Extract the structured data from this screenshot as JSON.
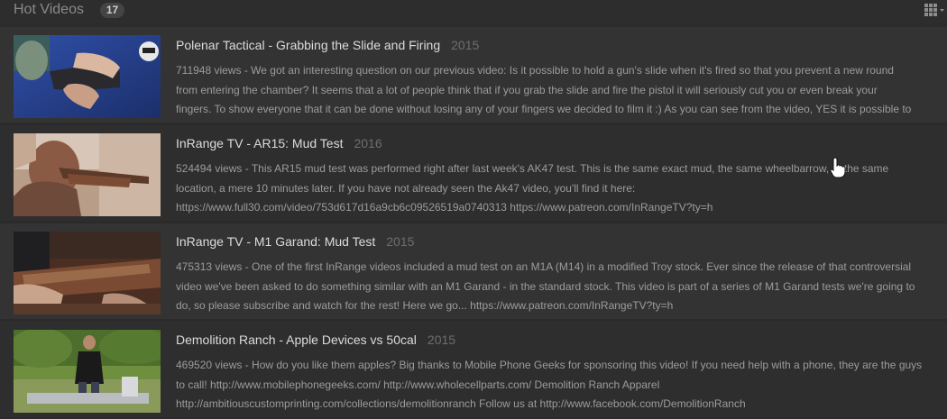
{
  "header": {
    "title": "Hot Videos",
    "count": "17",
    "view_toggle_icon": "grid-icon"
  },
  "videos": [
    {
      "title": "Polenar Tactical - Grabbing the Slide and Firing",
      "year": "2015",
      "description_lines": [
        "711948 views - We got an interesting question on our previous video: Is it possible to hold a gun's slide when it's fired so that you prevent a new round",
        "from entering the chamber? It seems that a lot of people think that if you grab the slide and fire the pistol it will seriously cut you or even break your",
        "fingers. To show everyone that it can be done without losing any of your fingers we decided to film it :) As you can see from the video, YES it is possible to"
      ]
    },
    {
      "title": "InRange TV - AR15: Mud Test",
      "year": "2016",
      "description_lines": [
        "524494 views - This AR15 mud test was performed right after last week's AK47 test. This is the same exact mud, the same wheelbarrow, at the same",
        "location, a mere 10 minutes later. If you have not already seen the Ak47 video, you'll find it here:",
        "https://www.full30.com/video/753d617d16a9cb6c09526519a0740313 https://www.patreon.com/InRangeTV?ty=h"
      ]
    },
    {
      "title": "InRange TV - M1 Garand: Mud Test",
      "year": "2015",
      "description_lines": [
        "475313 views - One of the first InRange videos included a mud test on an M1A (M14) in a modified Troy stock. Ever since the release of that controversial",
        "video we've been asked to do something similar with an M1 Garand - in the standard stock. This video is part of a series of M1 Garand tests we're going to",
        "do, so please subscribe and watch for the rest! Here we go... https://www.patreon.com/InRangeTV?ty=h"
      ]
    },
    {
      "title": "Demolition Ranch - Apple Devices vs 50cal",
      "year": "2015",
      "description_lines": [
        "469520 views - How do you like them apples? Big thanks to Mobile Phone Geeks for sponsoring this video! If you need help with a phone, they are the guys",
        "to call! http://www.mobilephonegeeks.com/ http://www.wholecellparts.com/ Demolition Ranch Apparel",
        "http://ambitiouscustomprinting.com/collections/demolitionranch Follow us at http://www.facebook.com/DemolitionRanch"
      ]
    }
  ],
  "colors": {
    "background": "#2b2b2b",
    "row": "#333333",
    "title": "#dcdcdc",
    "year": "#6e6e6e",
    "description": "#9c9c9c"
  },
  "cursor_icon": "hand-pointer-icon"
}
